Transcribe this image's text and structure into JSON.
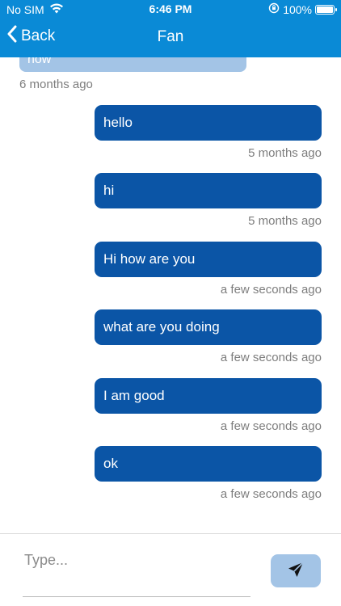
{
  "status_bar": {
    "carrier": "No SIM",
    "time": "6:46 PM",
    "battery_percent": "100%",
    "battery_level": 1.0,
    "icons": [
      "wifi-icon",
      "orientation-lock-icon",
      "battery-icon"
    ]
  },
  "nav": {
    "back_label": "Back",
    "title": "Fan",
    "icons": [
      "chevron-left-icon"
    ]
  },
  "messages": {
    "incoming_partial": {
      "text": "now",
      "time": "6 months ago"
    },
    "outgoing": [
      {
        "text": "hello",
        "time": "5 months ago"
      },
      {
        "text": "hi",
        "time": "5 months ago"
      },
      {
        "text": "Hi how are you",
        "time": "a few seconds ago"
      },
      {
        "text": "what are you doing",
        "time": "a few seconds ago"
      },
      {
        "text": "I am good",
        "time": "a few seconds ago"
      },
      {
        "text": "ok",
        "time": "a few seconds ago"
      }
    ]
  },
  "composer": {
    "placeholder": "Type...",
    "value": "",
    "send_icon": "send-icon"
  },
  "colors": {
    "header": "#0a8ad6",
    "outgoing_bubble": "#0b55a6",
    "incoming_bubble": "#a3c4e6",
    "send_button": "#a3c4e6",
    "timestamp": "#7d7d7d"
  }
}
